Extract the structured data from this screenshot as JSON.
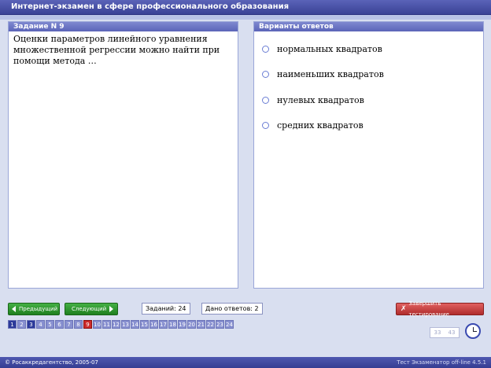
{
  "window": {
    "title": "Интернет-экзамен в сфере профессионального образования"
  },
  "question_panel": {
    "header": "Задание N 9",
    "text": "Оценки параметров линейного уравнения множественной регрессии можно найти при помощи метода …"
  },
  "answers_panel": {
    "header": "Варианты ответов",
    "options": [
      "нормальных квадратов",
      "наименьших квадратов",
      "нулевых квадратов",
      "средних квадратов"
    ]
  },
  "nav": {
    "prev_label": "Предыдущий",
    "next_label": "Следующий",
    "tasks_count": "Заданий: 24",
    "answers_given": "Дано ответов: 2",
    "finish_label": "Завершить тестирование"
  },
  "question_numbers": [
    "1",
    "2",
    "3",
    "4",
    "5",
    "6",
    "7",
    "8",
    "9",
    "10",
    "11",
    "12",
    "13",
    "14",
    "15",
    "16",
    "17",
    "18",
    "19",
    "20",
    "21",
    "22",
    "23",
    "24"
  ],
  "timer": {
    "minutes": "33",
    "seconds": "43"
  },
  "footer": {
    "copyright": "© Росаккредагентство, 2005-07",
    "version": "Тест Экзаменатор off-line 4.5.1"
  },
  "colors": {
    "accent": "#3a4296",
    "current": "#cc2a2a",
    "nav_green": "#1f7f1f"
  }
}
